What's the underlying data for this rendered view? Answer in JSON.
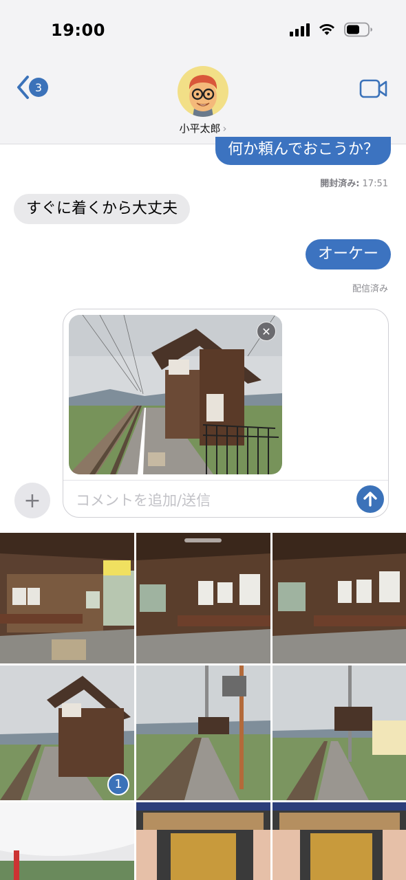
{
  "status_bar": {
    "time": "19:00"
  },
  "header": {
    "back_count": "3",
    "contact_name": "小平太郎",
    "chevron": "›"
  },
  "messages": [
    {
      "text": "何か頼んでおこうか？",
      "direction": "outgoing"
    },
    {
      "meta_label": "開封済み:",
      "meta_time": "17:51"
    },
    {
      "text": "すぐに着くから大丈夫",
      "direction": "incoming"
    },
    {
      "text": "オーケー",
      "direction": "outgoing"
    },
    {
      "meta_label": "配信済み"
    }
  ],
  "compose": {
    "placeholder": "コメントを追加/送信",
    "remove_symbol": "✕",
    "plus_symbol": "+"
  },
  "photo_grid": {
    "selected_count": "1"
  },
  "colors": {
    "accent": "#3b72b9",
    "outgoing_bubble": "#3c73c0",
    "incoming_bubble": "#e9e9eb"
  }
}
